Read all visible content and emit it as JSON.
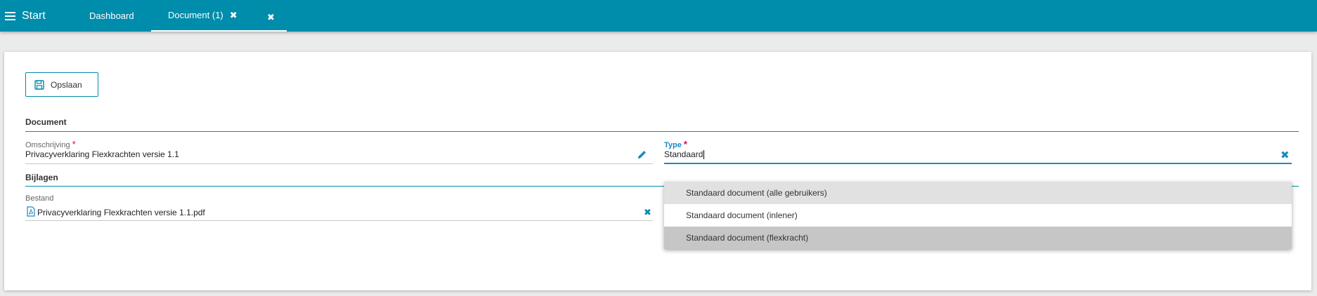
{
  "topbar": {
    "start_label": "Start",
    "tabs": [
      {
        "label": "Dashboard"
      },
      {
        "label": "Document (1)",
        "close_icon": "✖"
      },
      {
        "close_icon": "✖"
      }
    ]
  },
  "toolbar": {
    "save_label": "Opslaan"
  },
  "document": {
    "section_title": "Document",
    "omschrijving": {
      "label": "Omschrijving",
      "required": "*",
      "value": "Privacyverklaring Flexkrachten versie 1.1"
    },
    "type": {
      "label": "Type",
      "required": "*",
      "value": "Standaard"
    }
  },
  "bijlagen": {
    "section_title": "Bijlagen",
    "bestand": {
      "label": "Bestand",
      "value": "Privacyverklaring Flexkrachten versie 1.1.pdf"
    }
  },
  "dropdown": {
    "options": [
      {
        "label": "Standaard document (alle gebruikers)"
      },
      {
        "label": "Standaard document (inlener)"
      },
      {
        "label": "Standaard document (flexkracht)"
      }
    ]
  },
  "icons": {
    "menu": "hamburger-icon",
    "save": "floppy-disk-icon",
    "edit": "pencil-icon",
    "clear": "close-icon",
    "file": "pdf-file-icon"
  },
  "colors": {
    "brand": "#008cab",
    "accent": "#1a8bc0",
    "required": "#e0004d"
  }
}
